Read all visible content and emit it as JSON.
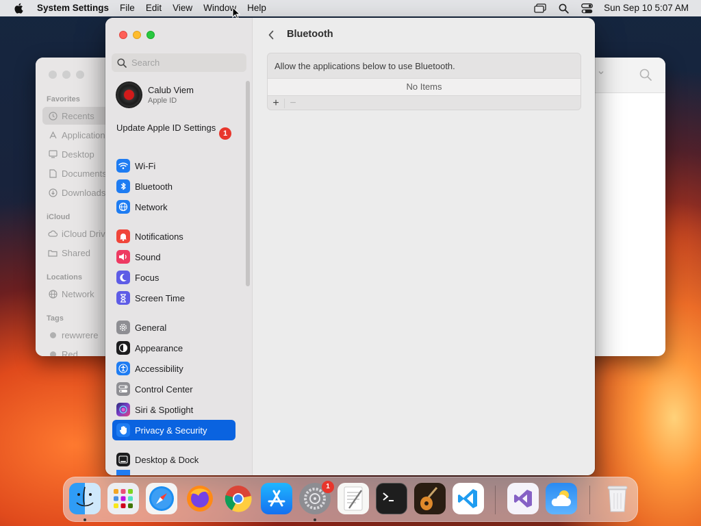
{
  "menubar": {
    "app_name": "System Settings",
    "menus": [
      "File",
      "Edit",
      "View",
      "Window",
      "Help"
    ],
    "clock": "Sun Sep 10  5:07 AM"
  },
  "finder": {
    "sections": {
      "favorites": "Favorites",
      "icloud": "iCloud",
      "locations": "Locations",
      "tags": "Tags"
    },
    "items": {
      "recents": "Recents",
      "applications": "Applications",
      "desktop": "Desktop",
      "documents": "Documents",
      "downloads": "Downloads",
      "icloud_drive": "iCloud Drive",
      "shared": "Shared",
      "network": "Network",
      "tag1": "rewwrere",
      "tag2": "Red"
    }
  },
  "sidebar": {
    "search_placeholder": "Search",
    "account_name": "Calub Viem",
    "account_sub": "Apple ID",
    "update_label": "Update Apple ID Settings",
    "update_badge": "1",
    "items": [
      {
        "label": "Wi-Fi",
        "icon": "wifi-icon",
        "color": "#1e7cf2"
      },
      {
        "label": "Bluetooth",
        "icon": "bluetooth-icon",
        "color": "#1e7cf2"
      },
      {
        "label": "Network",
        "icon": "globe-icon",
        "color": "#1e7cf2"
      },
      {
        "label": "Notifications",
        "icon": "bell-icon",
        "color": "#f0453a"
      },
      {
        "label": "Sound",
        "icon": "speaker-icon",
        "color": "#ee3a62"
      },
      {
        "label": "Focus",
        "icon": "moon-icon",
        "color": "#5e5ce6"
      },
      {
        "label": "Screen Time",
        "icon": "hourglass-icon",
        "color": "#5e5ce6"
      },
      {
        "label": "General",
        "icon": "gear-icon",
        "color": "#8e8e93"
      },
      {
        "label": "Appearance",
        "icon": "appearance-icon",
        "color": "#1c1c1e"
      },
      {
        "label": "Accessibility",
        "icon": "accessibility-icon",
        "color": "#1e7cf2"
      },
      {
        "label": "Control Center",
        "icon": "control-center-icon",
        "color": "#8e8e93"
      },
      {
        "label": "Siri & Spotlight",
        "icon": "siri-icon",
        "color": "#7b3fc9"
      },
      {
        "label": "Privacy & Security",
        "icon": "hand-icon",
        "color": "#1e7cf2"
      },
      {
        "label": "Desktop & Dock",
        "icon": "dock-icon",
        "color": "#1c1c1e"
      }
    ]
  },
  "content": {
    "title": "Bluetooth",
    "allow_text": "Allow the applications below to use Bluetooth.",
    "empty_text": "No Items",
    "add_label": "+",
    "remove_label": "−"
  },
  "dock": {
    "settings_badge": "1",
    "apps": [
      "Finder",
      "Launchpad",
      "Safari",
      "Firefox",
      "Chrome",
      "App Store",
      "System Settings",
      "TextEdit",
      "Terminal",
      "GarageBand",
      "Visual Studio Code",
      "Visual Studio",
      "Weather",
      "Trash"
    ]
  },
  "colors": {
    "accent": "#0a63e0",
    "badge": "#e8362c"
  }
}
